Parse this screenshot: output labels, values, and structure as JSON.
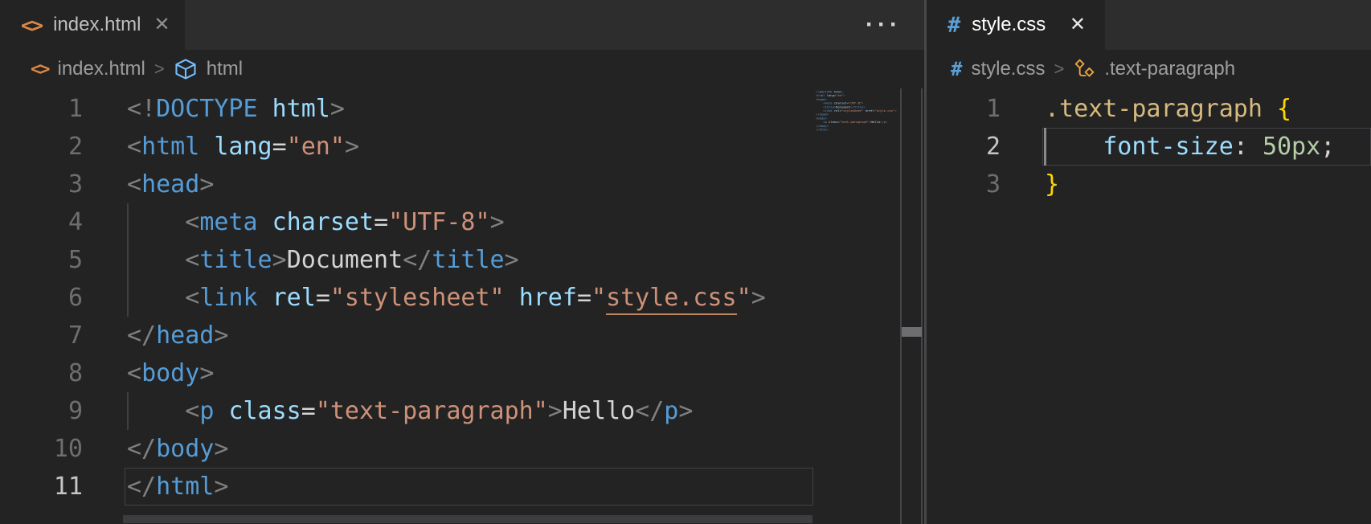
{
  "colors": {
    "editor_bg": "#232324",
    "tab_strip_bg": "#2d2d2e",
    "active_tab_bg": "#232324",
    "group_border": "#47474a",
    "html_icon_orange": "#dd8743",
    "css_icon_blue": "#5b9fd6",
    "cube_icon_blue": "#75beff",
    "class_icon_orange": "#e8a33d",
    "punct": "#808080",
    "tag": "#569cd6",
    "attr": "#9cdcfe",
    "op": "#d4d4d4",
    "str": "#ce9178",
    "text": "#d4d4d4",
    "link": "#ce9178",
    "ws": "#d4d4d4",
    "ind": "#d4d4d4",
    "sel": "#d7ba7d",
    "brace": "#ffd700",
    "prop": "#9cdcfe",
    "num": "#b5cea8",
    "semi": "#d4d4d4"
  },
  "common": {
    "breadcrumb_separator": ">",
    "close_glyph": "✕"
  },
  "left": {
    "tab": {
      "label": "index.html",
      "icon": "html-file-icon",
      "close": "✕"
    },
    "more_actions": "···",
    "breadcrumbs": {
      "file": "index.html",
      "symbol": "html"
    },
    "active_line": 11,
    "lines": [
      {
        "n": 1,
        "tokens": [
          [
            "punct",
            "<!"
          ],
          [
            "tag",
            "DOCTYPE"
          ],
          [
            "ws",
            " "
          ],
          [
            "attr",
            "html"
          ],
          [
            "punct",
            ">"
          ]
        ]
      },
      {
        "n": 2,
        "tokens": [
          [
            "punct",
            "<"
          ],
          [
            "tag",
            "html"
          ],
          [
            "ws",
            " "
          ],
          [
            "attr",
            "lang"
          ],
          [
            "op",
            "="
          ],
          [
            "str",
            "\"en\""
          ],
          [
            "punct",
            ">"
          ]
        ]
      },
      {
        "n": 3,
        "tokens": [
          [
            "punct",
            "<"
          ],
          [
            "tag",
            "head"
          ],
          [
            "punct",
            ">"
          ]
        ]
      },
      {
        "n": 4,
        "guide": true,
        "tokens": [
          [
            "ind",
            "    "
          ],
          [
            "punct",
            "<"
          ],
          [
            "tag",
            "meta"
          ],
          [
            "ws",
            " "
          ],
          [
            "attr",
            "charset"
          ],
          [
            "op",
            "="
          ],
          [
            "str",
            "\"UTF-8\""
          ],
          [
            "punct",
            ">"
          ]
        ]
      },
      {
        "n": 5,
        "guide": true,
        "tokens": [
          [
            "ind",
            "    "
          ],
          [
            "punct",
            "<"
          ],
          [
            "tag",
            "title"
          ],
          [
            "punct",
            ">"
          ],
          [
            "text",
            "Document"
          ],
          [
            "punct",
            "</"
          ],
          [
            "tag",
            "title"
          ],
          [
            "punct",
            ">"
          ]
        ]
      },
      {
        "n": 6,
        "guide": true,
        "tokens": [
          [
            "ind",
            "    "
          ],
          [
            "punct",
            "<"
          ],
          [
            "tag",
            "link"
          ],
          [
            "ws",
            " "
          ],
          [
            "attr",
            "rel"
          ],
          [
            "op",
            "="
          ],
          [
            "str",
            "\"stylesheet\""
          ],
          [
            "ws",
            " "
          ],
          [
            "attr",
            "href"
          ],
          [
            "op",
            "="
          ],
          [
            "str",
            "\""
          ],
          [
            "link",
            "style.css"
          ],
          [
            "str",
            "\""
          ],
          [
            "punct",
            ">"
          ]
        ]
      },
      {
        "n": 7,
        "tokens": [
          [
            "punct",
            "</"
          ],
          [
            "tag",
            "head"
          ],
          [
            "punct",
            ">"
          ]
        ]
      },
      {
        "n": 8,
        "tokens": [
          [
            "punct",
            "<"
          ],
          [
            "tag",
            "body"
          ],
          [
            "punct",
            ">"
          ]
        ]
      },
      {
        "n": 9,
        "guide": true,
        "tokens": [
          [
            "ind",
            "    "
          ],
          [
            "punct",
            "<"
          ],
          [
            "tag",
            "p"
          ],
          [
            "ws",
            " "
          ],
          [
            "attr",
            "class"
          ],
          [
            "op",
            "="
          ],
          [
            "str",
            "\"text-paragraph\""
          ],
          [
            "punct",
            ">"
          ],
          [
            "text",
            "Hello"
          ],
          [
            "punct",
            "</"
          ],
          [
            "tag",
            "p"
          ],
          [
            "punct",
            ">"
          ]
        ]
      },
      {
        "n": 10,
        "tokens": [
          [
            "punct",
            "</"
          ],
          [
            "tag",
            "body"
          ],
          [
            "punct",
            ">"
          ]
        ]
      },
      {
        "n": 11,
        "tokens": [
          [
            "punct",
            "</"
          ],
          [
            "tag",
            "html"
          ],
          [
            "punct",
            ">"
          ]
        ]
      }
    ]
  },
  "right": {
    "tab": {
      "label": "style.css",
      "icon": "css-file-icon",
      "close": "✕"
    },
    "breadcrumbs": {
      "file": "style.css",
      "symbol": ".text-paragraph"
    },
    "active_line": 2,
    "lines": [
      {
        "n": 1,
        "tokens": [
          [
            "sel",
            ".text-paragraph"
          ],
          [
            "ws",
            " "
          ],
          [
            "brace",
            "{"
          ]
        ]
      },
      {
        "n": 2,
        "guide": "active",
        "tokens": [
          [
            "ind",
            "    "
          ],
          [
            "prop",
            "font-size"
          ],
          [
            "op",
            ":"
          ],
          [
            "ws",
            " "
          ],
          [
            "num",
            "50px"
          ],
          [
            "semi",
            ";"
          ]
        ]
      },
      {
        "n": 3,
        "tokens": [
          [
            "brace",
            "}"
          ]
        ]
      }
    ]
  }
}
